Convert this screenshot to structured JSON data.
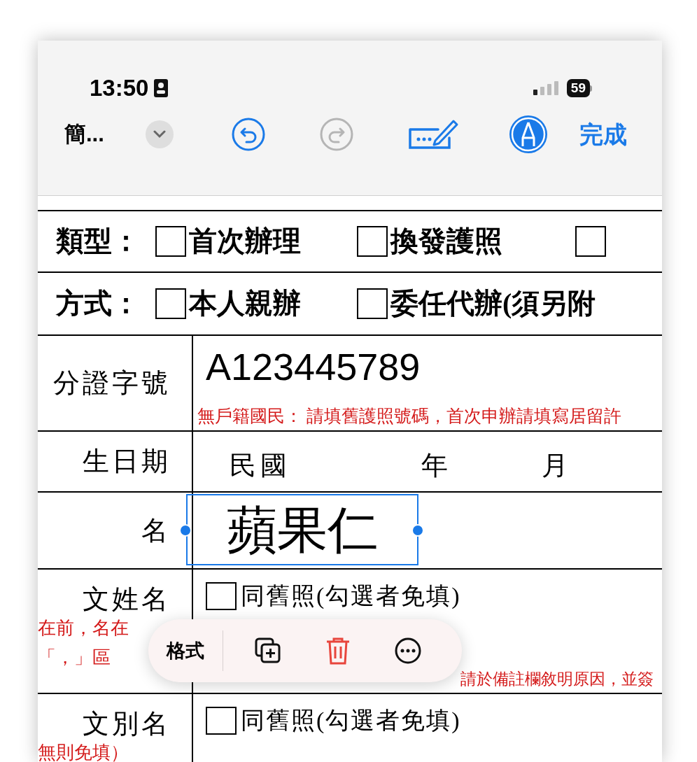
{
  "status_bar": {
    "time": "13:50",
    "battery": "59"
  },
  "toolbar": {
    "title": "簡...",
    "done": "完成"
  },
  "form": {
    "choice_rows": [
      {
        "label": "類型：",
        "options": [
          {
            "label": "首次辦理",
            "checked": false
          },
          {
            "label": "換發護照",
            "checked": false
          },
          {
            "checked": false
          }
        ]
      },
      {
        "label": "方式：",
        "options": [
          {
            "label": "本人親辦",
            "checked": false
          },
          {
            "label": "委任代辦(須另附",
            "checked": false
          }
        ]
      }
    ],
    "rows": [
      {
        "kind": "id",
        "label": "分證字號",
        "value": "A123445789",
        "note": "無戶籍國民： 請填舊護照號碼，首次申辦請填寫居留許"
      },
      {
        "kind": "date",
        "label": "生日期",
        "parts": [
          "民國",
          "年",
          "月"
        ]
      },
      {
        "kind": "name",
        "label": "名",
        "value": "蘋果仁",
        "selected": true
      },
      {
        "kind": "foreign",
        "label": "文姓名",
        "label_notes": [
          "在前，名在",
          "「，」區"
        ],
        "option": {
          "label": "同舊照(勾選者免填)",
          "checked": false
        },
        "note": "請於備註欄敘明原因，並簽"
      },
      {
        "kind": "foreign",
        "label": "文別名",
        "label_notes": [
          "無則免填）"
        ],
        "option": {
          "label": "同舊照(勾選者免填)",
          "checked": false
        }
      }
    ]
  },
  "context_menu": {
    "items": [
      {
        "kind": "text",
        "label": "格式"
      },
      {
        "kind": "duplicate"
      },
      {
        "kind": "delete"
      },
      {
        "kind": "more"
      }
    ]
  }
}
